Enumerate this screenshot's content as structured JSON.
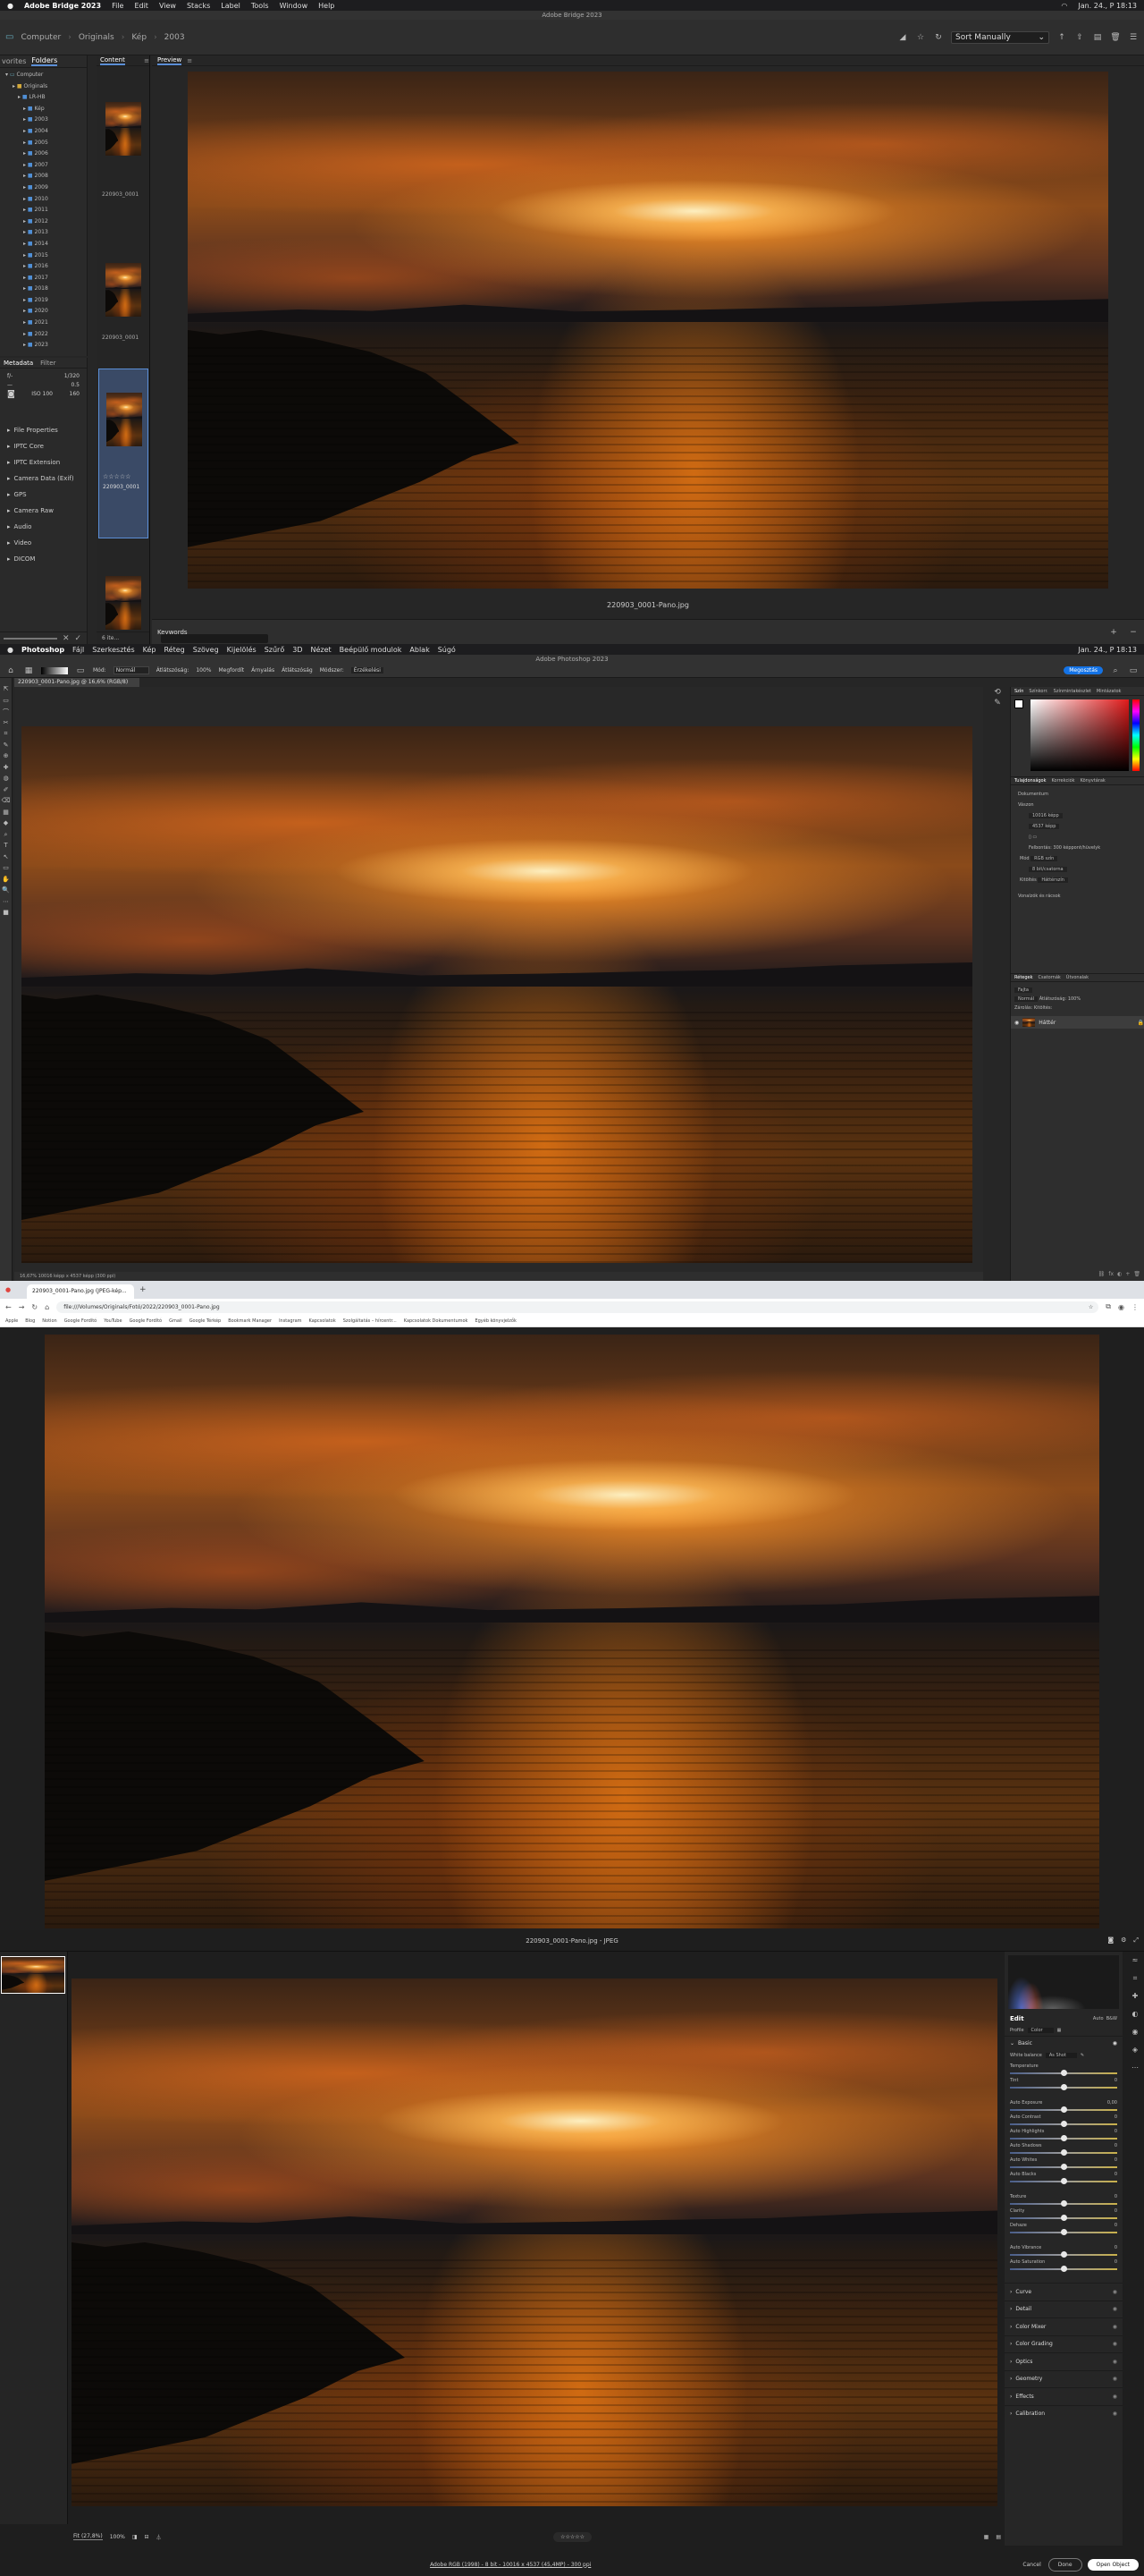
{
  "bridge": {
    "menu": {
      "apple": "",
      "app": "Adobe Bridge 2023",
      "items": [
        "File",
        "Edit",
        "View",
        "Stacks",
        "Label",
        "Tools",
        "Window",
        "Help"
      ],
      "clock": "Jan. 24., P 18:13"
    },
    "window_title": "Adobe Bridge 2023",
    "breadcrumb": [
      "Computer",
      "Originals",
      "Kép",
      "2003"
    ],
    "sort_label": "Sort Manually",
    "left_tabs": [
      "vorites",
      "Folders"
    ],
    "tree": {
      "root": "Computer",
      "items": [
        "Originals",
        "LR-HB",
        "Kép",
        "2003",
        "2004",
        "2005",
        "2006",
        "2007",
        "2008",
        "2009",
        "2010",
        "2011",
        "2012",
        "2013",
        "2014",
        "2015",
        "2016",
        "2017",
        "2018",
        "2019",
        "2020",
        "2021",
        "2022",
        "2023"
      ]
    },
    "meta_tabs": [
      "Metadata",
      "Filter"
    ],
    "meta_values": [
      "f/-",
      "—",
      "1/320",
      "0.5",
      "ISO 100",
      "160"
    ],
    "meta_sections": [
      "File Properties",
      "IPTC Core",
      "IPTC Extension",
      "Camera Data (Exif)",
      "GPS",
      "Camera Raw",
      "Audio",
      "Video",
      "DICOM"
    ],
    "content_tab": "Content",
    "preview_tab": "Preview",
    "thumbs": [
      "220903_0001",
      "220903_0001",
      "220903_0001",
      ""
    ],
    "stars": "☆☆☆☆☆",
    "preview_caption": "220903_0001-Pano.jpg",
    "keywords_label": "Keywords",
    "count_label": "6 ite..."
  },
  "photoshop": {
    "menu": {
      "app": "Photoshop",
      "items": [
        "Fájl",
        "Szerkesztés",
        "Kép",
        "Réteg",
        "Szöveg",
        "Kijelölés",
        "Szűrő",
        "3D",
        "Nézet",
        "Beépülő modulok",
        "Ablak",
        "Súgó"
      ],
      "clock": "Jan. 24., P 18:13"
    },
    "window_title": "Adobe Photoshop 2023",
    "options": {
      "mode_label": "Mód:",
      "mode": "Normál",
      "opacity_label": "Átlátszóság:",
      "opacity": "100%",
      "reverse": "Megfordít",
      "dither": "Árnyalás",
      "transparency": "Átlátszóság",
      "method_label": "Módszer:",
      "method": "Érzékelési"
    },
    "share_button": "Megosztás",
    "doc_tab": "220903_0001-Pano.jpg @ 16,6% (RGB/8)",
    "status": "16,67%   10016 képp x 4537 képp (300 ppi)",
    "color_tabs": [
      "Szín",
      "Színkorr.",
      "Színmintakészlet",
      "Mintázatok"
    ],
    "props_tabs": [
      "Tulajdonságok",
      "Korrekciók",
      "Könyvtárak"
    ],
    "props": {
      "doc_label": "Dokumentum",
      "canvas_label": "Vászon",
      "w": "10016 képp",
      "h": "4537 képp",
      "res_label": "Felbontás:",
      "res": "300 képpont/hüvelyk",
      "mode_label": "Mód",
      "mode": "RGB szín",
      "depth": "8 bit/csatorna",
      "fill_label": "Kitöltés",
      "fill": "Háttérszín",
      "rulers_label": "Vonalzók és rácsok"
    },
    "layers_tabs": [
      "Rétegek",
      "Csatornák",
      "Útvonalak"
    ],
    "layer_kind": "Fajta",
    "blend": "Normál",
    "opacity_label": "Átlátszóság:",
    "opacity": "100%",
    "lock_label": "Zárolás:",
    "fill_label": "Kitöltés:",
    "layer_name": "Háttér"
  },
  "chrome": {
    "tab_title": "220903_0001-Pano.jpg (JPEG-kép...",
    "url": "file:///Volumes/Originals/Fotó/2022/220903_0001-Pano.jpg",
    "bookmarks": [
      "Apple",
      "Blog",
      "Notion",
      "Google Fordító",
      "YouTube",
      "Google Fordító",
      "Gmail",
      "Google Térkép",
      "Bookmark Manager",
      "Instagram",
      "Kapcsolatok",
      "Szolgáltatás – hírcentr...",
      "Kapcsolatok Dokumentumok",
      "Egyéb könyvjelzők"
    ]
  },
  "acr": {
    "title": "220903_0001-Pano.jpg  -  JPEG",
    "edit_label": "Edit",
    "auto": "Auto",
    "bw": "B&W",
    "profile_label": "Profile",
    "profile": "Color",
    "basic": "Basic",
    "wb_label": "White balance",
    "wb": "As Shot",
    "sliders": [
      {
        "label": "Temperature",
        "value": "",
        "pos": 0.5
      },
      {
        "label": "Tint",
        "value": "0",
        "pos": 0.5
      },
      {
        "label": "Auto Exposure",
        "value": "0,00",
        "pos": 0.5
      },
      {
        "label": "Auto Contrast",
        "value": "0",
        "pos": 0.5
      },
      {
        "label": "Auto Highlights",
        "value": "0",
        "pos": 0.5
      },
      {
        "label": "Auto Shadows",
        "value": "0",
        "pos": 0.5
      },
      {
        "label": "Auto Whites",
        "value": "0",
        "pos": 0.5
      },
      {
        "label": "Auto Blacks",
        "value": "0",
        "pos": 0.5
      },
      {
        "label": "Texture",
        "value": "0",
        "pos": 0.5
      },
      {
        "label": "Clarity",
        "value": "0",
        "pos": 0.5
      },
      {
        "label": "Dehaze",
        "value": "0",
        "pos": 0.5
      },
      {
        "label": "Auto Vibrance",
        "value": "0",
        "pos": 0.5
      },
      {
        "label": "Auto Saturation",
        "value": "0",
        "pos": 0.5
      }
    ],
    "sections": [
      "Curve",
      "Detail",
      "Color Mixer",
      "Color Grading",
      "Optics",
      "Geometry",
      "Effects",
      "Calibration"
    ],
    "zoom_fit": "Fit (27,8%)",
    "zoom": "100%",
    "rating": "☆☆☆☆☆",
    "footer_info": "Adobe RGB (1998) - 8 bit - 10016 x 4537 (45,4MP) - 300 ppi",
    "cancel": "Cancel",
    "done": "Done",
    "open": "Open Object"
  }
}
